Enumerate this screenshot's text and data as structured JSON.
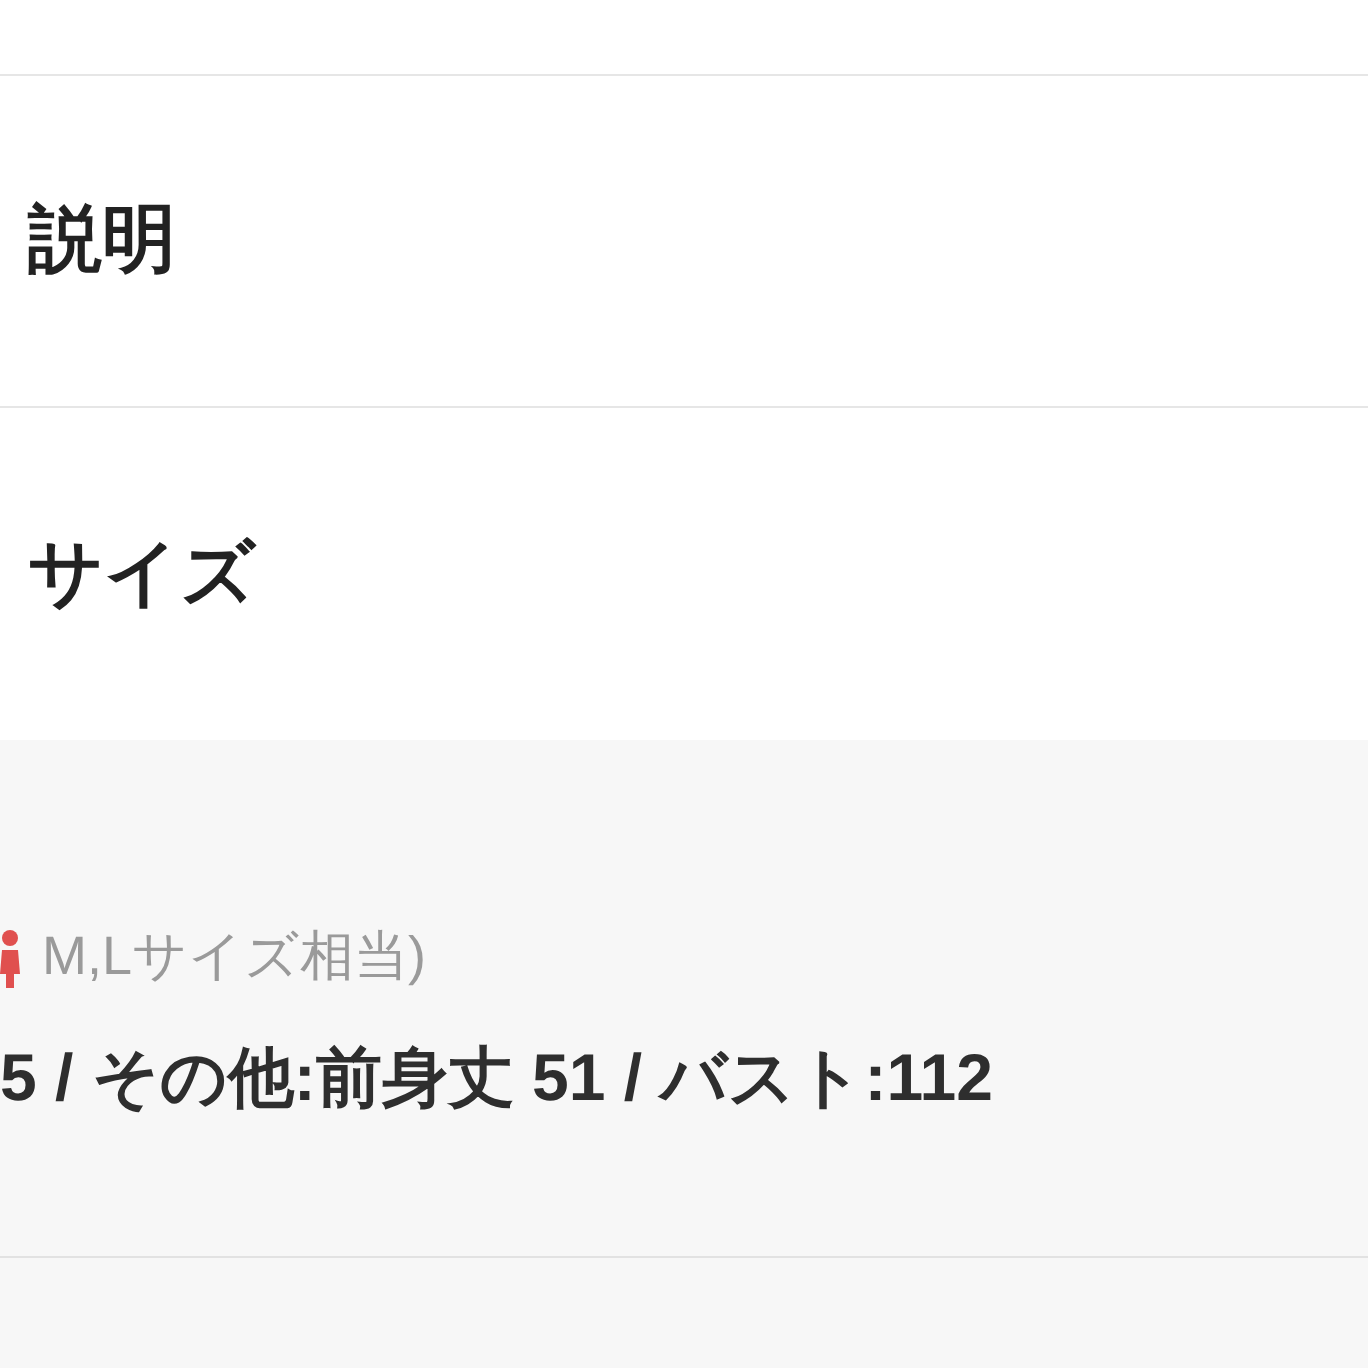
{
  "sections": [
    {
      "title": "説明"
    },
    {
      "title": "サイズ"
    }
  ],
  "size_panel": {
    "note": "M,Lサイズ相当)",
    "measurements": "5 / その他:前身丈 51 / バスト:112"
  }
}
